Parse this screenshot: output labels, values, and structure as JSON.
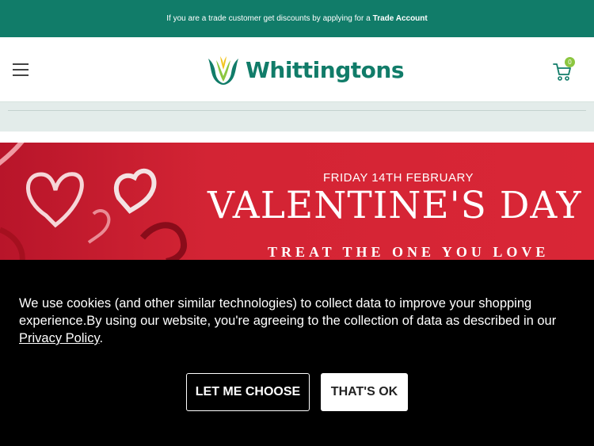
{
  "topbar": {
    "message": "If you are a trade customer get discounts by applying for a",
    "link_label": "Trade Account",
    "bg_color": "#117c69"
  },
  "header": {
    "menu_icon": "hamburger-menu-icon",
    "logo_icon": "whittingtons-tulip-logo-icon",
    "logo_text": "Whittingtons",
    "cart_icon": "shopping-cart-icon",
    "cart_count": "0"
  },
  "banner": {
    "date": "FRIDAY 14TH FEBRUARY",
    "title": "VALENTINE'S DAY",
    "subtitle": "TREAT THE ONE YOU LOVE",
    "decor_icon": "paper-hearts-icon"
  },
  "cookie_banner": {
    "message": "We use cookies (and other similar technologies) to collect data to improve your shopping experience.By using our website, you're agreeing to the collection of data as described in our",
    "policy_link": "Privacy Policy",
    "policy_suffix": ".",
    "choose_button": "LET ME CHOOSE",
    "ok_button": "THAT'S OK"
  },
  "colors": {
    "brand_green": "#117c69",
    "badge_green": "#8cc640",
    "banner_red": "#d32434"
  }
}
